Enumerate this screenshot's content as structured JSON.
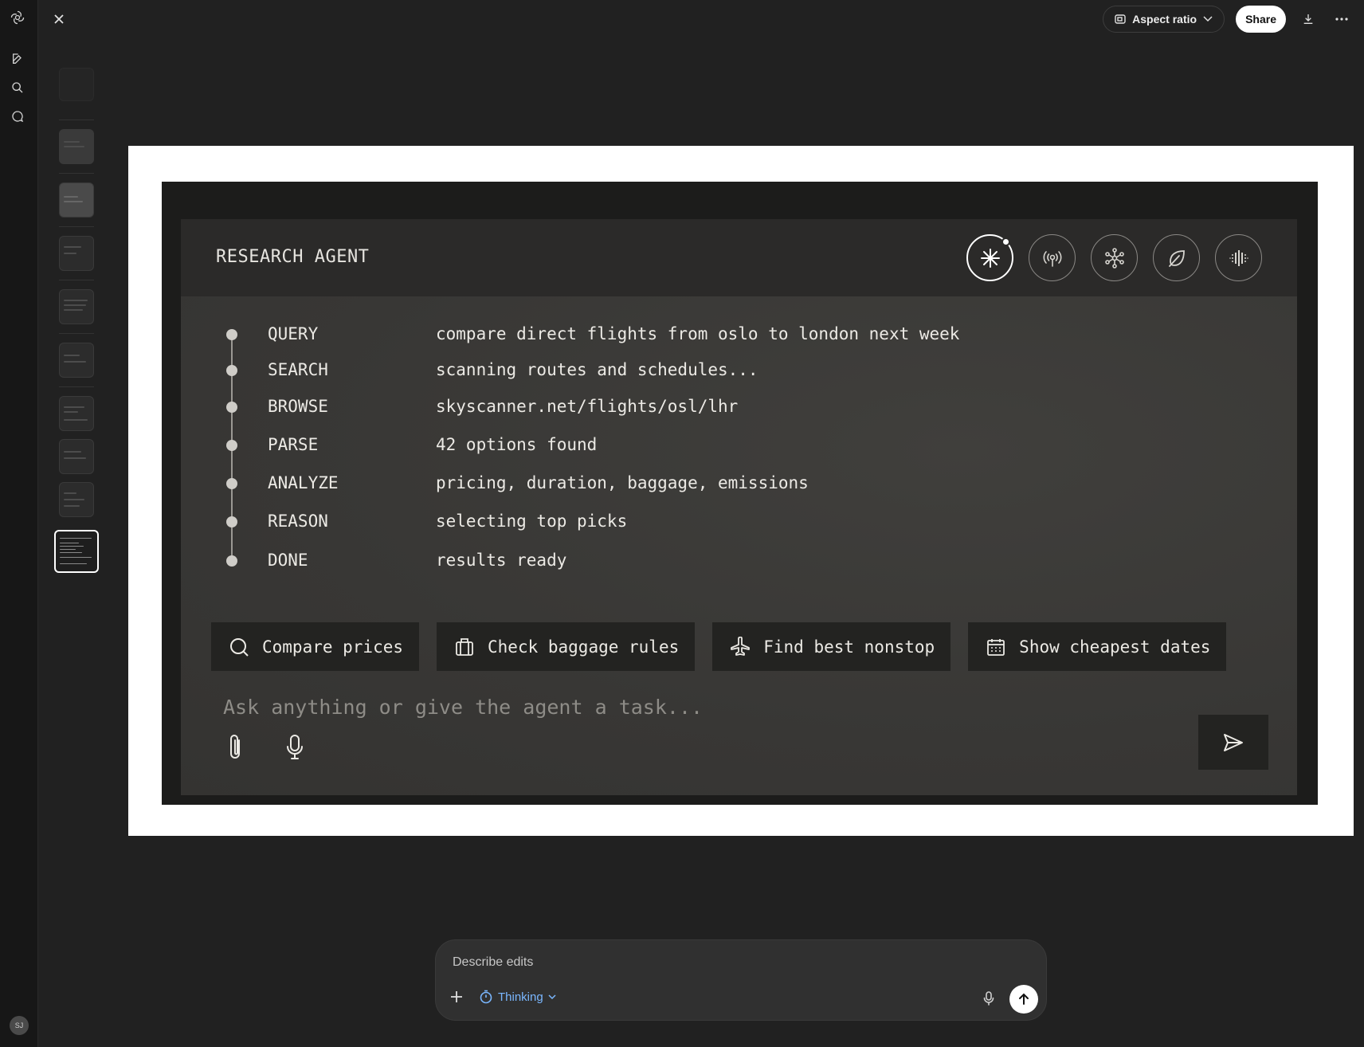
{
  "rail": {
    "logo_icon": "openai-logo-icon",
    "items": [
      "new-chat-icon",
      "search-icon",
      "chat-bubble-icon"
    ],
    "avatar_initials": "SJ"
  },
  "topbar": {
    "aspect_label": "Aspect ratio",
    "share_label": "Share"
  },
  "agent": {
    "title": "RESEARCH AGENT",
    "mode_icons": [
      "asterisk-icon",
      "broadcast-icon",
      "network-icon",
      "leaf-icon",
      "waveform-icon"
    ],
    "active_mode": "asterisk-icon",
    "steps": [
      {
        "label": "QUERY",
        "value": "compare direct flights from oslo to london next week"
      },
      {
        "label": "SEARCH",
        "value": "scanning routes and schedules..."
      },
      {
        "label": "BROWSE",
        "value": "skyscanner.net/flights/osl/lhr"
      },
      {
        "label": "PARSE",
        "value": "42 options found"
      },
      {
        "label": "ANALYZE",
        "value": "pricing, duration, baggage, emissions"
      },
      {
        "label": "REASON",
        "value": "selecting top picks"
      },
      {
        "label": "DONE",
        "value": "results ready"
      }
    ],
    "chips": [
      {
        "label": "Compare prices",
        "icon": "search-icon"
      },
      {
        "label": "Check baggage rules",
        "icon": "luggage-icon"
      },
      {
        "label": "Find best nonstop",
        "icon": "plane-icon"
      },
      {
        "label": "Show cheapest dates",
        "icon": "calendar-icon"
      }
    ],
    "input_placeholder": "Ask anything or give the agent a task..."
  },
  "composer": {
    "placeholder": "Describe edits",
    "mode_label": "Thinking"
  },
  "colors": {
    "app_bg": "#212121",
    "panel_bg": "#3a3937",
    "accent_link": "#7ab7ff"
  }
}
